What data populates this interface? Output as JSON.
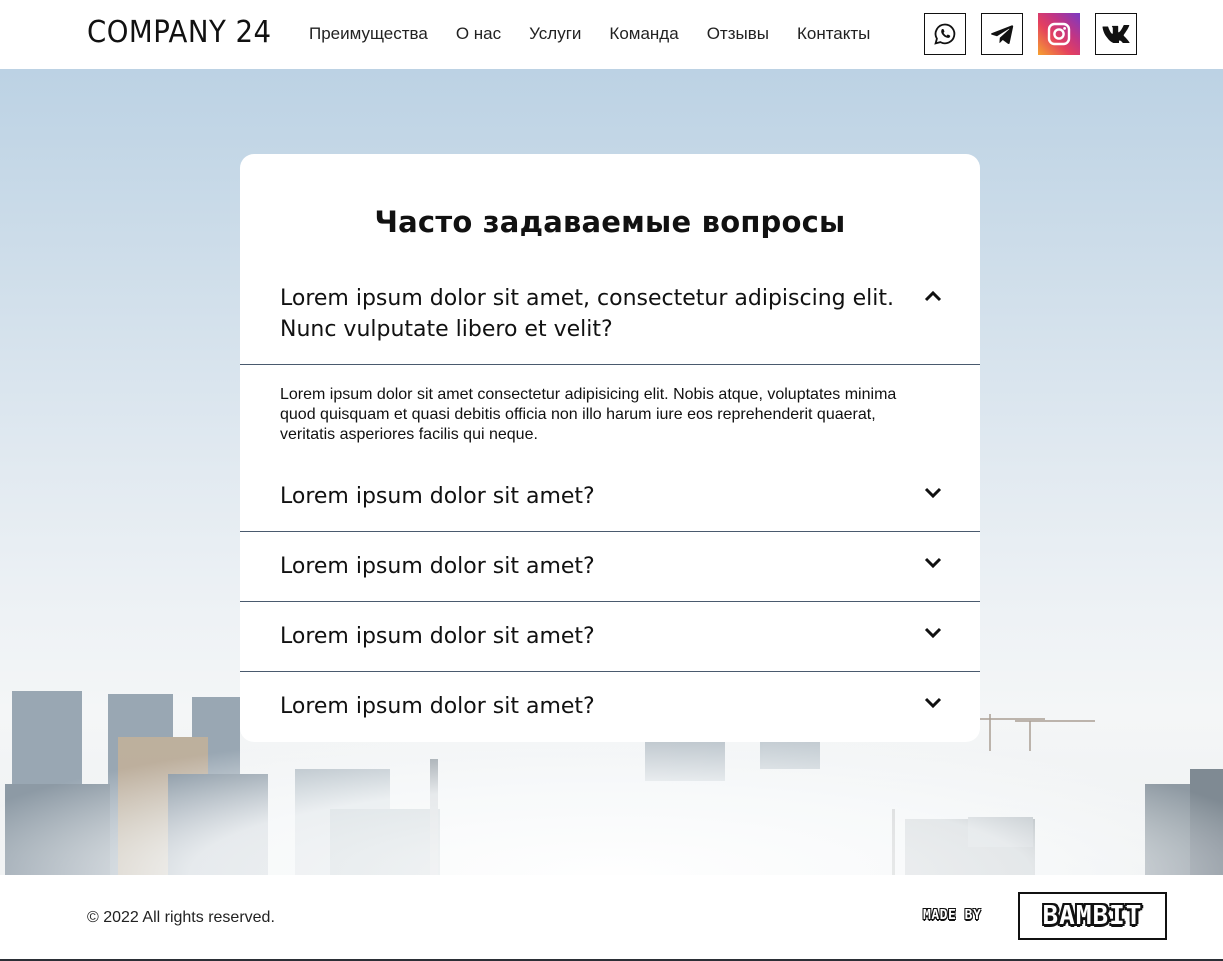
{
  "header": {
    "logo": "COMPANY 24",
    "nav": [
      "Преимущества",
      "О нас",
      "Услуги",
      "Команда",
      "Отзывы",
      "Контакты"
    ],
    "socials": [
      {
        "name": "whatsapp-icon"
      },
      {
        "name": "telegram-icon"
      },
      {
        "name": "instagram-icon"
      },
      {
        "name": "vk-icon"
      }
    ]
  },
  "faq": {
    "title": "Часто задаваемые вопросы",
    "items": [
      {
        "question": "Lorem ipsum dolor sit amet, consectetur adipiscing elit. Nunc vulputate libero et velit?",
        "answer": "Lorem ipsum dolor sit amet consectetur adipisicing elit. Nobis atque, voluptates minima quod quisquam et quasi debitis officia non illo harum iure eos reprehenderit quaerat, veritatis asperiores facilis qui neque.",
        "expanded": true
      },
      {
        "question": "Lorem ipsum dolor sit amet?",
        "expanded": false
      },
      {
        "question": "Lorem ipsum dolor sit amet?",
        "expanded": false
      },
      {
        "question": "Lorem ipsum dolor sit amet?",
        "expanded": false
      },
      {
        "question": "Lorem ipsum dolor sit amet?",
        "expanded": false
      }
    ]
  },
  "footer": {
    "copyright": "© 2022 All rights reserved.",
    "made_by": "MADE BY",
    "studio": "BAMBIT"
  },
  "colors": {
    "instagram_gradient": [
      "#f6a230",
      "#e4405f",
      "#c13584",
      "#7a3ac4"
    ],
    "divider": "#4a5a6e"
  }
}
